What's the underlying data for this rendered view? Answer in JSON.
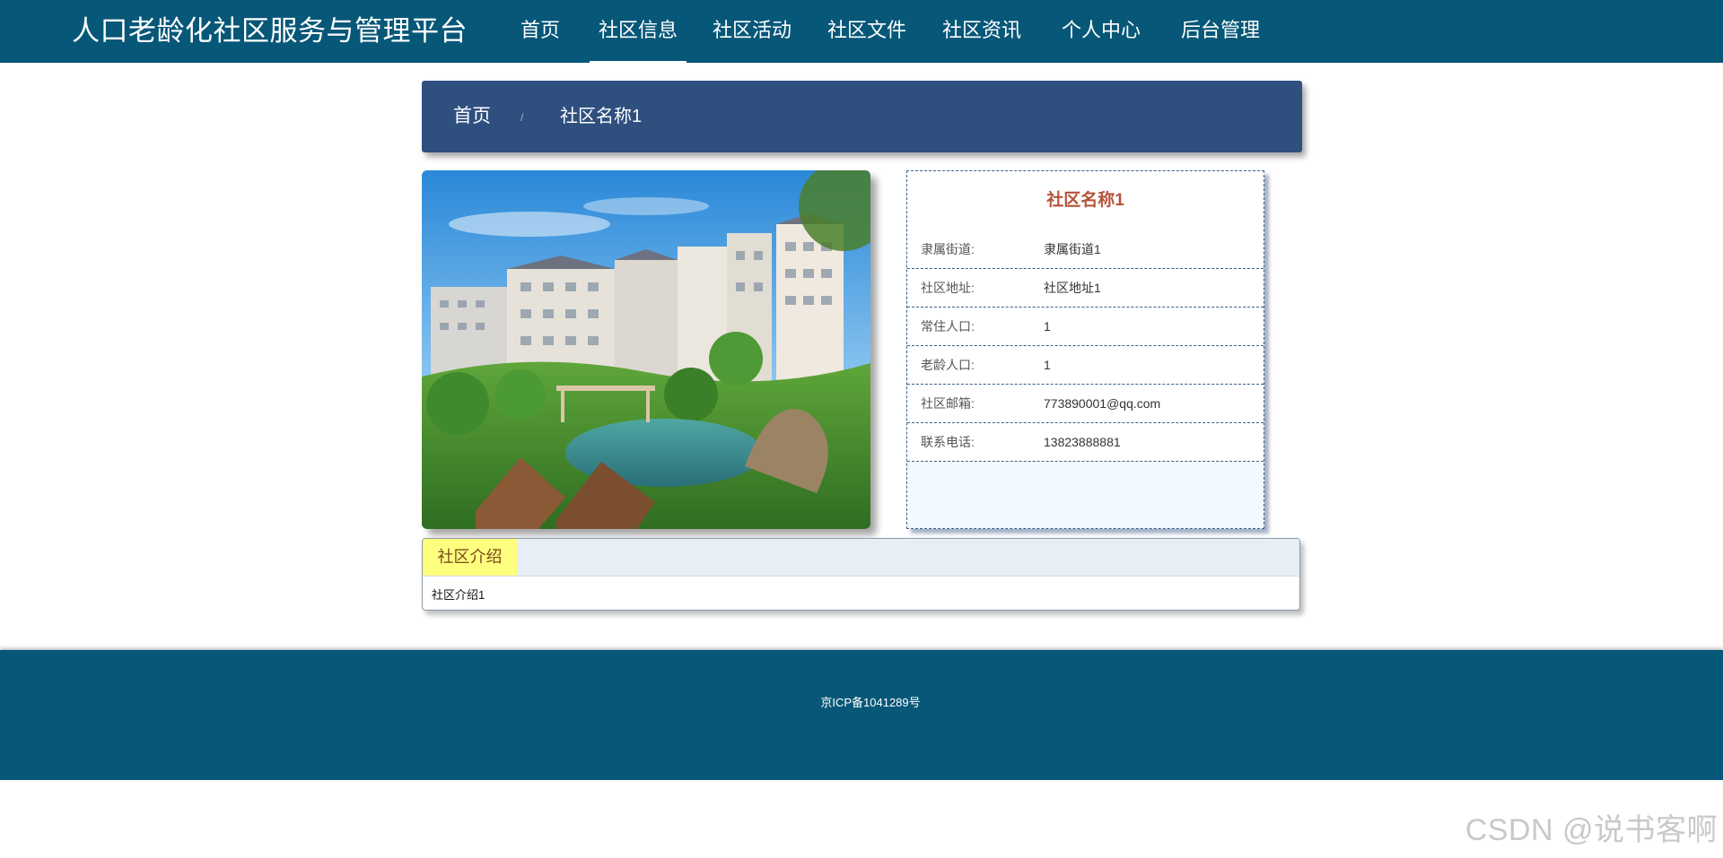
{
  "header": {
    "brand": "人口老龄化社区服务与管理平台",
    "nav": [
      "首页",
      "社区信息",
      "社区活动",
      "社区文件",
      "社区资讯",
      "个人中心",
      "后台管理"
    ],
    "active_nav": "社区信息"
  },
  "breadcrumb": {
    "home": "首页",
    "separator": "/",
    "current": "社区名称1"
  },
  "community": {
    "name": "社区名称1",
    "fields": [
      {
        "label": "隶属街道:",
        "value": "隶属街道1"
      },
      {
        "label": "社区地址:",
        "value": "社区地址1"
      },
      {
        "label": "常住人口:",
        "value": "1"
      },
      {
        "label": "老龄人口:",
        "value": "1"
      },
      {
        "label": "社区邮箱:",
        "value": "773890001@qq.com"
      },
      {
        "label": "联系电话:",
        "value": "13823888881"
      }
    ]
  },
  "intro": {
    "tab_label": "社区介绍",
    "content": "社区介绍1"
  },
  "footer": {
    "icp": "京ICP备1041289号"
  },
  "watermark": "CSDN @说书客啊",
  "colors": {
    "nav_bg": "#075778",
    "breadcrumb_bg": "#2f4f7f",
    "title_red": "#b5523a",
    "tab_yellow": "#ffff7f"
  }
}
